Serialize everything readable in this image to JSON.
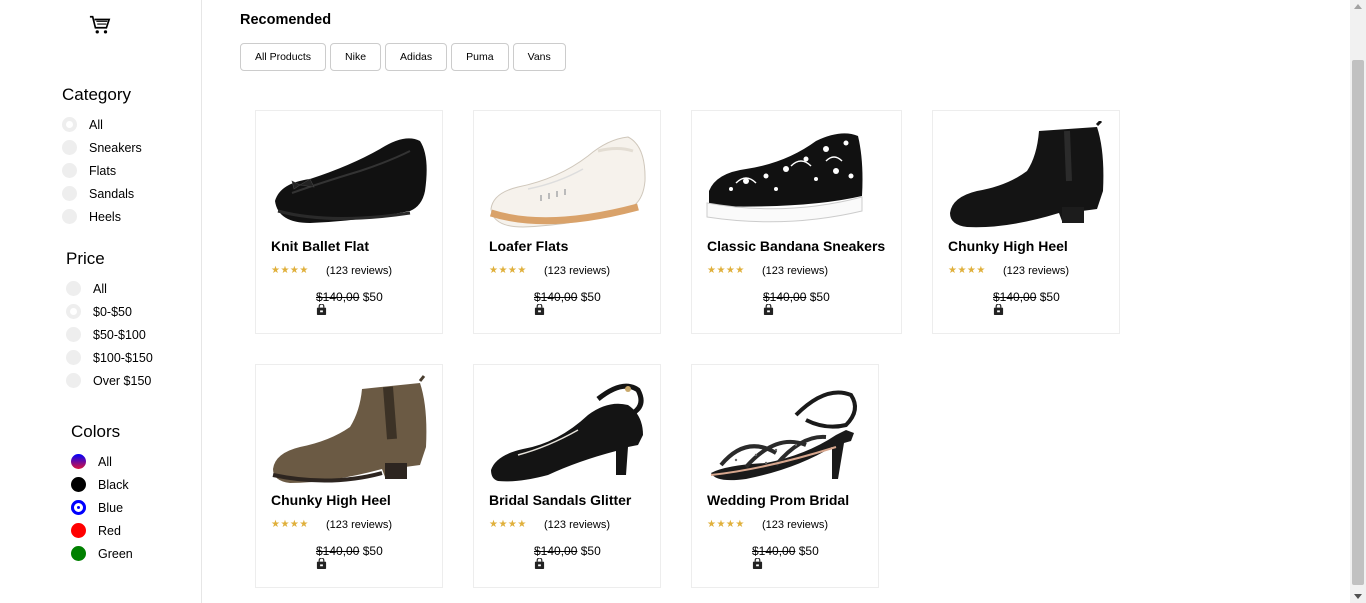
{
  "sidebar": {
    "category": {
      "title": "Category",
      "items": [
        {
          "label": "All",
          "checked": true
        },
        {
          "label": "Sneakers",
          "checked": false
        },
        {
          "label": "Flats",
          "checked": false
        },
        {
          "label": "Sandals",
          "checked": false
        },
        {
          "label": "Heels",
          "checked": false
        }
      ]
    },
    "price": {
      "title": "Price",
      "items": [
        {
          "label": "All",
          "checked": false
        },
        {
          "label": "$0-$50",
          "checked": true
        },
        {
          "label": "$50-$100",
          "checked": false
        },
        {
          "label": "$100-$150",
          "checked": false
        },
        {
          "label": "Over $150",
          "checked": false
        }
      ]
    },
    "colors": {
      "title": "Colors",
      "items": [
        {
          "label": "All",
          "color": "linear-gradient(blue, crimson)"
        },
        {
          "label": "Black",
          "color": "#000000"
        },
        {
          "label": "Blue",
          "color": "#0000ff"
        },
        {
          "label": "Red",
          "color": "#ff0000"
        },
        {
          "label": "Green",
          "color": "#008000"
        }
      ]
    }
  },
  "main": {
    "title": "Recomended",
    "filters": [
      "All Products",
      "Nike",
      "Adidas",
      "Puma",
      "Vans"
    ],
    "products": [
      {
        "title": "Knit Ballet Flat",
        "stars": "★★★★",
        "reviews": "(123 reviews)",
        "old_price": "$140,00",
        "price": "$50"
      },
      {
        "title": "Loafer Flats",
        "stars": "★★★★",
        "reviews": "(123 reviews)",
        "old_price": "$140,00",
        "price": "$50"
      },
      {
        "title": "Classic Bandana Sneakers",
        "stars": "★★★★",
        "reviews": "(123 reviews)",
        "old_price": "$140,00",
        "price": "$50"
      },
      {
        "title": "Chunky High Heel",
        "stars": "★★★★",
        "reviews": "(123 reviews)",
        "old_price": "$140,00",
        "price": "$50"
      },
      {
        "title": "Chunky High Heel",
        "stars": "★★★★",
        "reviews": "(123 reviews)",
        "old_price": "$140,00",
        "price": "$50"
      },
      {
        "title": "Bridal Sandals Glitter",
        "stars": "★★★★",
        "reviews": "(123 reviews)",
        "old_price": "$140,00",
        "price": "$50"
      },
      {
        "title": "Wedding Prom Bridal",
        "stars": "★★★★",
        "reviews": "(123 reviews)",
        "old_price": "$140,00",
        "price": "$50"
      }
    ]
  }
}
